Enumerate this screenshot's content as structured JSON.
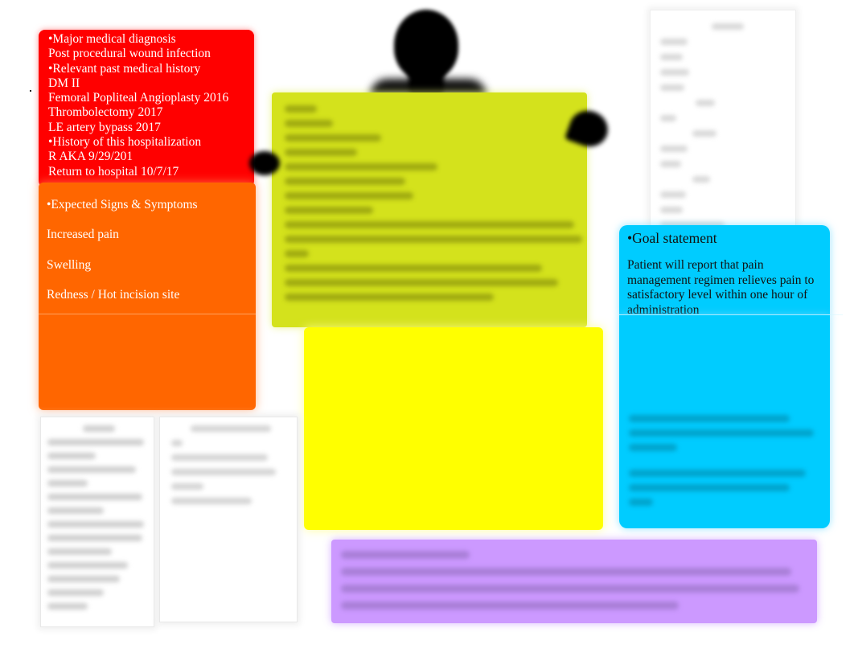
{
  "document": {
    "type": "concept map",
    "diagnosis_box": {
      "color": "#ff0000",
      "lines": [
        "•Major medical diagnosis",
        "Post procedural wound infection",
        "•Relevant past medical history",
        "DM II",
        "Femoral Popliteal Angioplasty 2016",
        "Thrombolectomy 2017",
        "LE artery bypass 2017",
        "•History of this hospitalization",
        "R AKA 9/29/201",
        "Return to hospital 10/7/17"
      ]
    },
    "signs_box": {
      "color": "#ff6600",
      "lines": [
        "•Expected Signs & Symptoms",
        "Increased pain",
        "Swelling",
        "Redness / Hot incision site"
      ]
    },
    "goal_box": {
      "color": "#00ccff",
      "title": "•Goal statement",
      "body": "Patient will report that pain management regimen relieves pain to satisfactory level within one hour of administration"
    },
    "center_box": {
      "color": "#d4e21c"
    },
    "yellow_box": {
      "color": "#ffff00"
    },
    "purple_box": {
      "color": "#cc99ff"
    },
    "labs_panel": {
      "color": "#ffffff"
    },
    "meds_panel": {
      "color": "#ffffff"
    },
    "nursing_panel": {
      "color": "#ffffff"
    },
    "figure": {
      "icon": "person-silhouette-icon"
    }
  }
}
